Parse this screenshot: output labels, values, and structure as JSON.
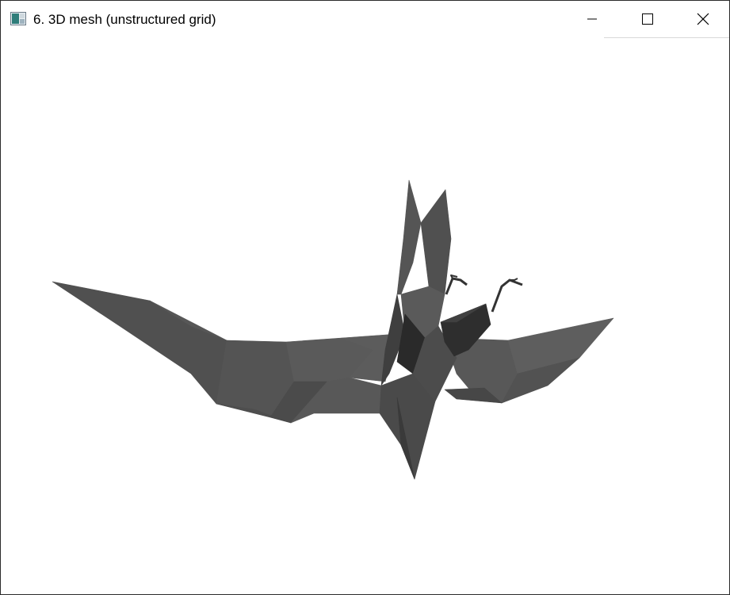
{
  "window": {
    "title": "6. 3D mesh (unstructured grid)",
    "app_icon": "vtk-window-icon",
    "controls": {
      "minimize_icon": "minimize-icon",
      "maximize_icon": "maximize-icon",
      "close_icon": "close-icon"
    }
  },
  "viewport": {
    "background": "#ffffff",
    "mesh_color": "#555555",
    "object": "triangulated bird mesh"
  }
}
